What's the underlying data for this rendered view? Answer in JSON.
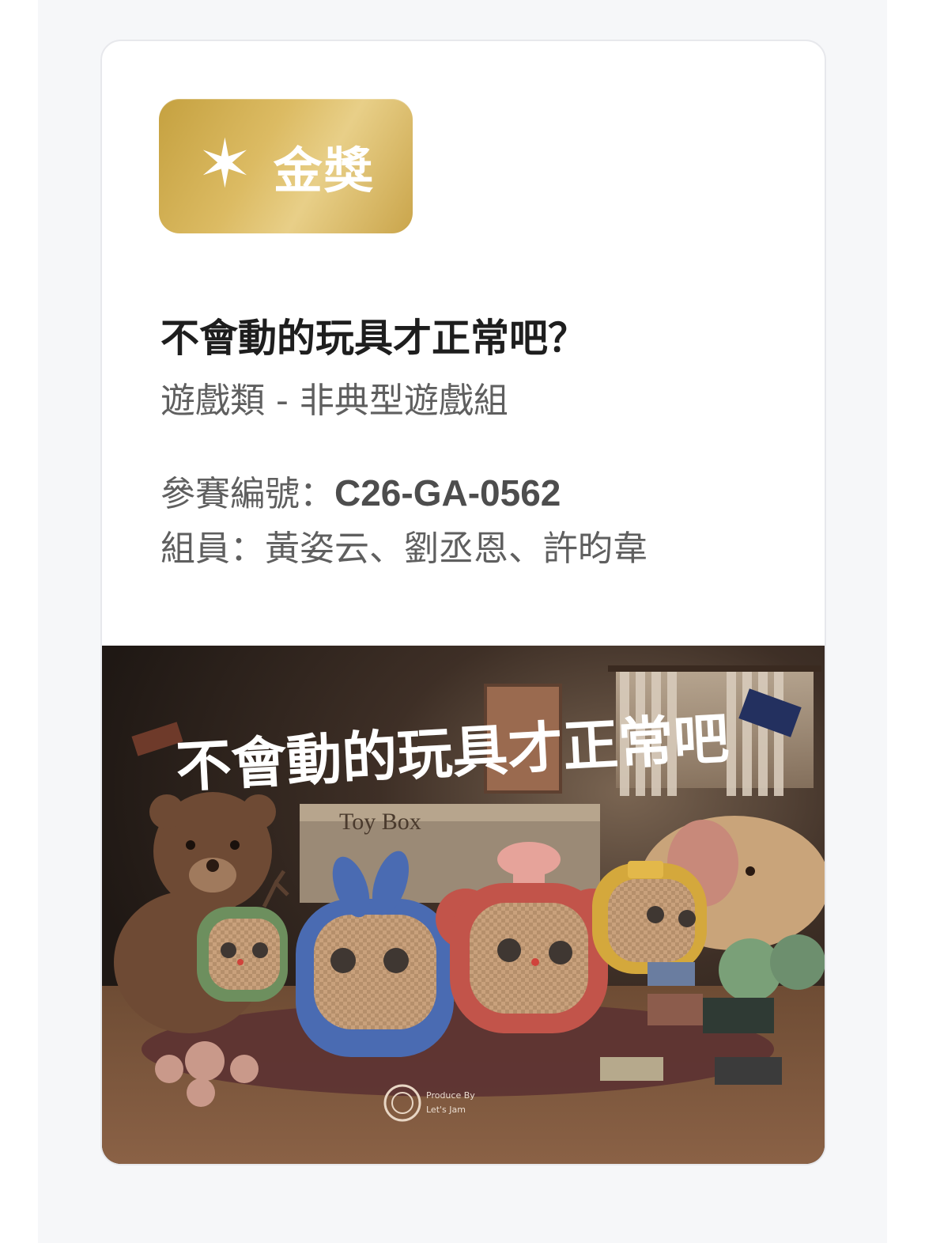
{
  "award": {
    "icon": "star-icon",
    "label": "金獎",
    "color": "#d4b256"
  },
  "project": {
    "title": "不會動的玩具才正常吧？",
    "category": "遊戲類 - 非典型遊戲組",
    "entry_label": "參賽編號：",
    "entry_value": "C26-GA-0562",
    "members_label": "組員：",
    "members_value": "黃姿云、劉丞恩、許昀韋"
  },
  "poster": {
    "title_text": "不會動的玩具才正常吧",
    "box_text": "Toy Box",
    "credit_line1": "Produce By",
    "credit_line2": "Let's Jam"
  }
}
